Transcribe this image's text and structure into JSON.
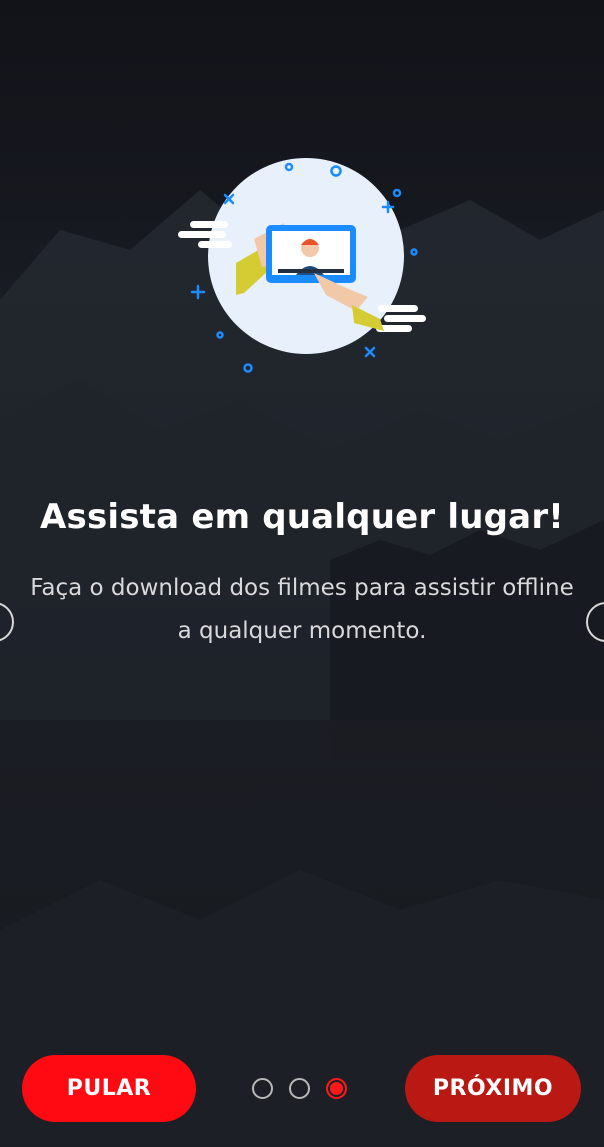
{
  "onboarding": {
    "title": "Assista em qualquer lugar!",
    "subtitle": "Faça o download dos filmes para assistir offline a qualquer momento.",
    "skip_label": "PULAR",
    "next_label": "PRÓXIMO",
    "page_total": 3,
    "page_current": 3
  },
  "colors": {
    "skip_button": "#ff0a13",
    "next_button": "#ba1812",
    "active_dot": "#ff1a1a",
    "illustration_accent": "#1a8cff"
  },
  "icons": {
    "illustration": "tablet-video-illustration",
    "left_arrow": "chevron-left-icon",
    "right_arrow": "chevron-right-icon"
  }
}
